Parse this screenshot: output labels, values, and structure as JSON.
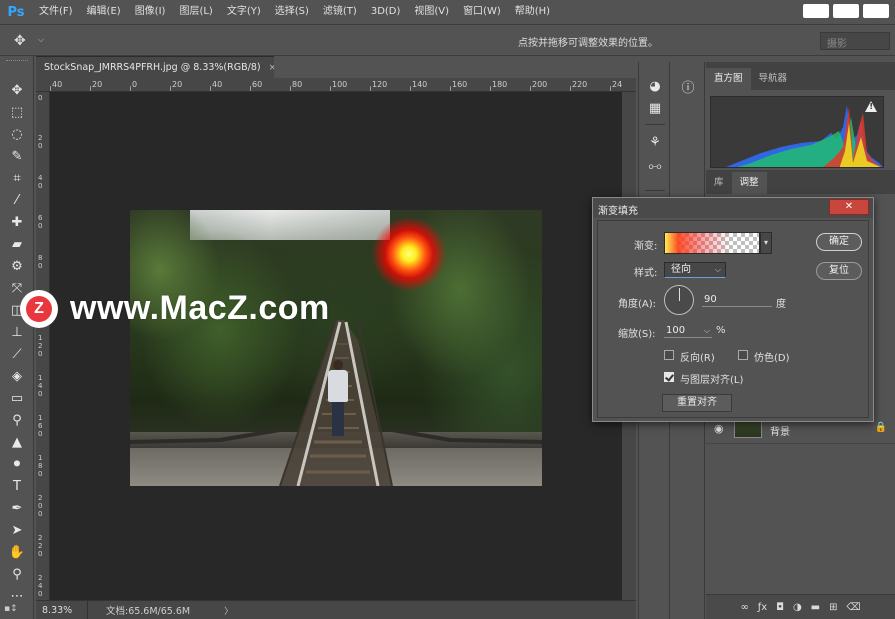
{
  "app": {
    "logo": "Ps"
  },
  "menu": [
    "文件(F)",
    "编辑(E)",
    "图像(I)",
    "图层(L)",
    "文字(Y)",
    "选择(S)",
    "滤镜(T)",
    "3D(D)",
    "视图(V)",
    "窗口(W)",
    "帮助(H)"
  ],
  "options_bar": {
    "hint": "点按并拖移可调整效果的位置。",
    "field": "摄影"
  },
  "document": {
    "tab_label": "StockSnap_JMRRS4PFRH.jpg @ 8.33%(RGB/8)",
    "close_glyph": "×",
    "ruler_top_labels": [
      "40",
      "20",
      "0",
      "20",
      "40",
      "60",
      "80",
      "100",
      "120",
      "140",
      "160",
      "180",
      "200",
      "220",
      "24"
    ],
    "ruler_left_labels": [
      "0",
      "2 0",
      "4 0",
      "6 0",
      "8 0",
      "1 0 0",
      "1 2 0",
      "1 4 0",
      "1 6 0",
      "1 8 0",
      "2 0 0",
      "2 2 0",
      "2 4 0"
    ]
  },
  "status": {
    "zoom": "8.33%",
    "doc_info": "文档:65.6M/65.6M",
    "caret": "〉"
  },
  "watermark": {
    "badge_letter": "Z",
    "text": "www.MacZ.com"
  },
  "panels": {
    "top_tabs": [
      {
        "label": "直方图",
        "active": true
      },
      {
        "label": "导航器",
        "active": false
      }
    ],
    "mid_tabs": [
      {
        "label": "库",
        "active": false
      },
      {
        "label": "调整",
        "active": true
      }
    ],
    "histogram_warning": "!",
    "layer_background": {
      "label": "背景",
      "lock_glyph": "🔒"
    }
  },
  "dialog": {
    "title": "渐变填充",
    "close_glyph": "✕",
    "gradient_label": "渐变:",
    "style_label": "样式:",
    "style_value": "径向",
    "angle_label": "角度(A):",
    "angle_value": "90",
    "angle_unit": "度",
    "scale_label": "缩放(S):",
    "scale_value": "100",
    "scale_unit": "%",
    "reverse_label": "反向(R)",
    "reverse_checked": false,
    "dither_label": "仿色(D)",
    "dither_checked": false,
    "align_label": "与图层对齐(L)",
    "align_checked": true,
    "reset_align_label": "重置对齐",
    "ok_label": "确定",
    "reset_label": "复位"
  },
  "colors": {
    "ps_blue": "#31a8ff",
    "close_red": "#c8463c",
    "watermark_red": "#e8383d"
  }
}
